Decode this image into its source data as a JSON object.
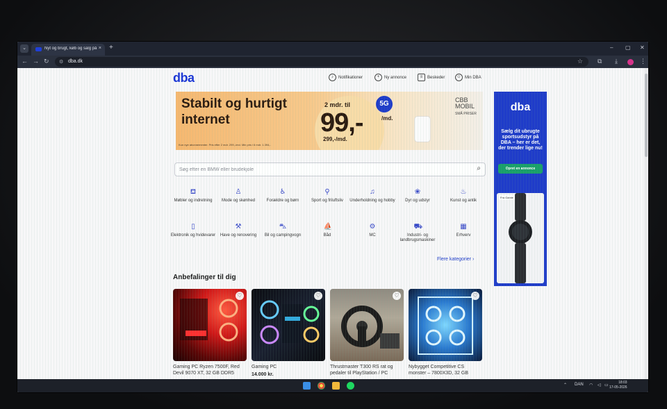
{
  "browser": {
    "tab_title": "Nyt og brugt, køb og salg på D",
    "tab_close": "×",
    "new_tab": "+",
    "url": "dba.dk",
    "window_controls": [
      "–",
      "▢",
      "✕"
    ]
  },
  "site": {
    "logo": "dba",
    "topnav": [
      {
        "label": "Notifikationer",
        "icon": "bell-icon"
      },
      {
        "label": "Ny annonce",
        "icon": "plus-circle-icon"
      },
      {
        "label": "Beskeder",
        "icon": "chat-icon"
      },
      {
        "label": "Min DBA",
        "icon": "user-icon"
      }
    ]
  },
  "ad": {
    "headline": "Stabilt og hurtigt internet",
    "months": "2 mdr. til",
    "price": "99,-",
    "per_month": "/md.",
    "after_price": "299,-/md.",
    "badge": "5G",
    "brand_line1": "CBB",
    "brand_line2": "MOBIL",
    "brand_tagline": "SMÅ PRISER",
    "footnote": "Kun nye abonnementer. Pris efter 2 mdr. 299,-/md. Min pris i 6 mdr. 1.394,-"
  },
  "search": {
    "placeholder": "Søg efter en BMW eller brudekjole"
  },
  "categories": [
    {
      "label": "Møbler og indretning",
      "icon": "sofa-icon"
    },
    {
      "label": "Mode og skønhed",
      "icon": "tshirt-icon"
    },
    {
      "label": "Forældre og børn",
      "icon": "stroller-icon"
    },
    {
      "label": "Sport og friluftsliv",
      "icon": "bike-icon"
    },
    {
      "label": "Underholdning og hobby",
      "icon": "guitar-icon"
    },
    {
      "label": "Dyr og udstyr",
      "icon": "paw-icon"
    },
    {
      "label": "Kunst og antik",
      "icon": "teapot-icon"
    },
    {
      "label": "Elektronik og hvidevarer",
      "icon": "phone-icon"
    },
    {
      "label": "Have og renovering",
      "icon": "drill-icon"
    },
    {
      "label": "Bil og campingvogn",
      "icon": "car-icon"
    },
    {
      "label": "Båd",
      "icon": "boat-icon"
    },
    {
      "label": "MC",
      "icon": "motorcycle-icon"
    },
    {
      "label": "Industri- og landbrugsmaskiner",
      "icon": "tractor-icon"
    },
    {
      "label": "Erhverv",
      "icon": "building-icon"
    }
  ],
  "more_categories": "Flere kategorier  ›",
  "recommendations": {
    "title": "Anbefalinger til dig",
    "items": [
      {
        "title": "Gaming PC Ryzen 7500F, Red Devil 9070 XT, 32 GB DDR5",
        "price": ""
      },
      {
        "title": "Gaming PC",
        "price": "14.000 kr."
      },
      {
        "title": "Thrustmaster T300 RS rat og pedaler til PlayStation / PC",
        "price": ""
      },
      {
        "title": "Nybygget Competitive CS monster – 7800X3D, 32 GB",
        "price": ""
      }
    ]
  },
  "side_ad": {
    "logo": "dba",
    "text": "Sælg dit ubrugte sportsudstyr på DBA – her er det, der trender lige nu!",
    "button": "Opret en annonce",
    "badge": "Fra Gamle"
  },
  "taskbar": {
    "language": "DAN",
    "time": "18:03",
    "date": "17-05-2026"
  },
  "colors": {
    "brand_blue": "#1934d6",
    "cta_green": "#19a06a"
  }
}
